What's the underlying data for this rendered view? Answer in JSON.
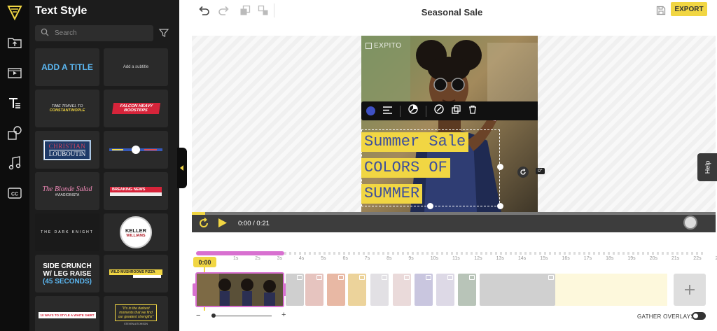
{
  "app": {
    "accent": "#f1d643",
    "brand_pink": "#d870d0"
  },
  "rail": {
    "items": [
      {
        "icon": "logo-icon"
      },
      {
        "icon": "folder-upload-icon"
      },
      {
        "icon": "media-library-icon"
      },
      {
        "icon": "text-icon"
      },
      {
        "icon": "shapes-icon"
      },
      {
        "icon": "music-note-icon"
      },
      {
        "icon": "closed-captions-icon"
      }
    ]
  },
  "panel": {
    "title": "Text Style",
    "search_placeholder": "Search",
    "tiles": {
      "t1": "ADD A TITLE",
      "t2": "Add a subtitle",
      "t3a": "TIME TRAVEL TO",
      "t3b": "CONSTANTINOPLE",
      "t4a": "FALCON HEAVY",
      "t4b": "BOOSTERS",
      "t5a": "CHRISTIAN",
      "t5b": "LOUBOUTIN",
      "t7": "The Blonde Salad",
      "t7b": "#VIAGIOINSTA",
      "t8": "BREAKING NEWS",
      "t9": "THE DARK KNIGHT",
      "t10a": "KELLER",
      "t10b": "WILLIAMS",
      "t11a": "SIDE CRUNCH",
      "t11b": "W/ LEG RAISE",
      "t11c": "(45 SECONDS)",
      "t12": "WILD MUSHROOMS PIZZA",
      "t13": "10 WAYS TO STYLE A WHITE SHIRT",
      "t14a": "\"It's in the darkest",
      "t14b": "moments that we find",
      "t14c": "our greatest strengths\"",
      "t14d": "STEVEN AITCHISON"
    }
  },
  "topbar": {
    "title": "Seasonal Sale",
    "export_label": "EXPORT"
  },
  "canvas": {
    "watermark": "EXPITO",
    "lines": [
      "Summer Sale",
      "COLORS OF",
      "SUMMER"
    ],
    "rotation": "0°"
  },
  "player": {
    "current": "0:00",
    "separator": "/",
    "total": "0:21",
    "progress": 0.025
  },
  "timeline": {
    "playhead": "0:00",
    "ticks": [
      "1s",
      "2s",
      "3s",
      "4s",
      "5s",
      "6s",
      "7s",
      "8s",
      "9s",
      "10s",
      "11s",
      "12s",
      "13s",
      "14s",
      "15s",
      "16s",
      "17s",
      "18s",
      "19s",
      "20s",
      "21s",
      "22s",
      "23s"
    ],
    "gather_label": "GATHER OVERLAYS",
    "gather_on": false
  },
  "help": {
    "label": "Help"
  }
}
